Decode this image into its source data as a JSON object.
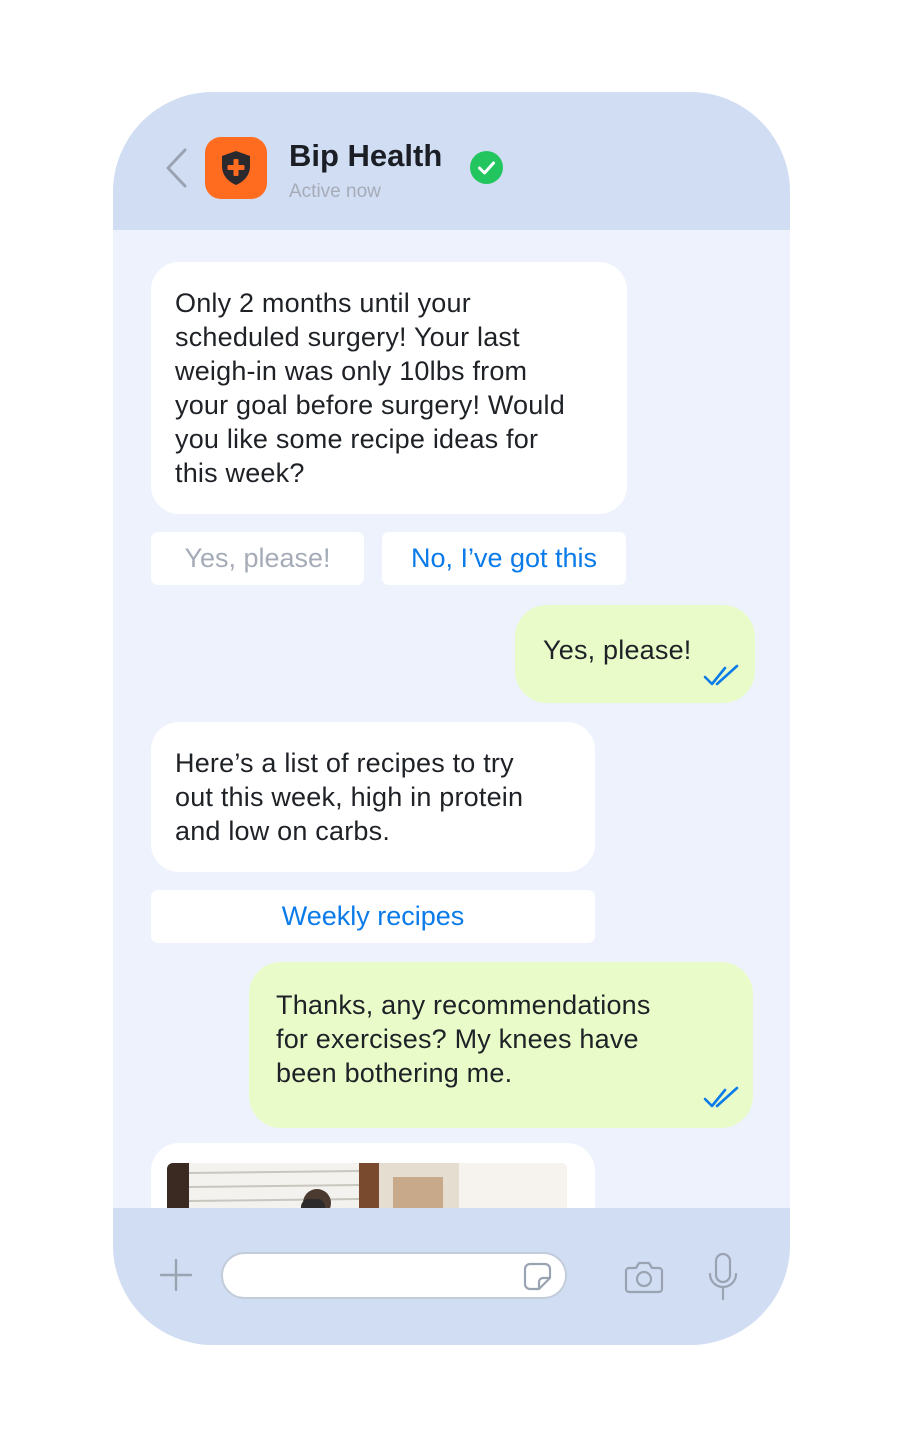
{
  "header": {
    "title": "Bip Health",
    "status": "Active now",
    "avatar_color": "#ff6b1f",
    "verified_color": "#22c55e",
    "icons": {
      "back": "chevron-left-icon",
      "avatar": "shield-plus-icon",
      "verified": "check-circle-icon"
    }
  },
  "messages": [
    {
      "from": "bot",
      "lines": [
        "Only 2 months until your",
        "scheduled surgery! Your last",
        "weigh-in was only 10lbs from",
        "your goal before surgery! Would",
        "you like some recipe ideas for",
        "this week?"
      ]
    },
    {
      "from": "user",
      "text": "Yes, please!",
      "read": true
    },
    {
      "from": "bot",
      "lines": [
        "Here’s a list of recipes to try",
        "out this week, high in protein",
        "and low on carbs."
      ]
    },
    {
      "from": "user",
      "lines": [
        "Thanks, any recommendations",
        "for exercises? My knees have",
        "been bothering me."
      ],
      "read": true
    }
  ],
  "quick_replies": [
    {
      "label": "Yes, please!",
      "state": "used"
    },
    {
      "label": "No, I’ve got this",
      "state": "active"
    }
  ],
  "link_button": {
    "label": "Weekly recipes"
  },
  "composer": {
    "placeholder": "",
    "icons": [
      "plus-icon",
      "sticker-icon",
      "camera-icon",
      "microphone-icon"
    ]
  },
  "colors": {
    "accent": "#0a7be8",
    "header_bg": "#d1ddf2",
    "chat_bg": "#edf2fc",
    "user_bubble": "#e9fbc9",
    "bot_bubble": "#ffffff",
    "muted_text": "#a5acb8"
  }
}
